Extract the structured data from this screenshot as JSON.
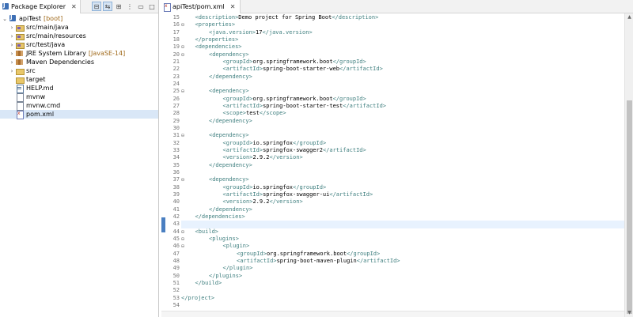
{
  "explorer": {
    "tab_label": "Package Explorer",
    "close_glyph": "✕",
    "toolbar": [
      "collapse-all",
      "link-with-editor",
      "filter",
      "view-menu",
      "minimize",
      "maximize"
    ],
    "tree": [
      {
        "label": "apiTest",
        "deco": "[boot]",
        "icon": "project-icon",
        "level": 0,
        "arrow": "⌄"
      },
      {
        "label": "src/main/java",
        "icon": "source-folder-icon",
        "level": 1,
        "arrow": "›"
      },
      {
        "label": "src/main/resources",
        "icon": "source-folder-icon",
        "level": 1,
        "arrow": "›"
      },
      {
        "label": "src/test/java",
        "icon": "source-folder-icon",
        "level": 1,
        "arrow": "›"
      },
      {
        "label": "JRE System Library",
        "deco": "[JavaSE-14]",
        "icon": "library-icon",
        "level": 1,
        "arrow": "›"
      },
      {
        "label": "Maven Dependencies",
        "icon": "library-icon",
        "level": 1,
        "arrow": "›"
      },
      {
        "label": "src",
        "icon": "folder-icon",
        "level": 1,
        "arrow": "›"
      },
      {
        "label": "target",
        "icon": "folder-icon",
        "level": 1,
        "arrow": ""
      },
      {
        "label": "HELP.md",
        "icon": "markdown-file-icon",
        "level": 1,
        "arrow": ""
      },
      {
        "label": "mvnw",
        "icon": "file-icon",
        "level": 1,
        "arrow": ""
      },
      {
        "label": "mvnw.cmd",
        "icon": "file-icon",
        "level": 1,
        "arrow": ""
      },
      {
        "label": "pom.xml",
        "icon": "xml-file-icon",
        "level": 1,
        "arrow": "",
        "selected": true
      }
    ]
  },
  "editor": {
    "tab_label": "apiTest/pom.xml",
    "current_line": "43",
    "lines": [
      {
        "n": "15",
        "fold": "",
        "indent": 1,
        "parts": [
          [
            "tag",
            "<description>"
          ],
          [
            "txt",
            "Demo project for Spring Boot"
          ],
          [
            "tag",
            "</description>"
          ]
        ]
      },
      {
        "n": "16",
        "fold": "⊖",
        "indent": 1,
        "parts": [
          [
            "tag",
            "<properties>"
          ]
        ]
      },
      {
        "n": "17",
        "fold": "",
        "indent": 2,
        "parts": [
          [
            "tag",
            "<java.version>"
          ],
          [
            "txt",
            "17"
          ],
          [
            "tag",
            "</java.version>"
          ]
        ]
      },
      {
        "n": "18",
        "fold": "",
        "indent": 1,
        "parts": [
          [
            "tag",
            "</properties>"
          ]
        ]
      },
      {
        "n": "19",
        "fold": "⊖",
        "indent": 1,
        "parts": [
          [
            "tag",
            "<dependencies>"
          ]
        ]
      },
      {
        "n": "20",
        "fold": "⊖",
        "indent": 2,
        "parts": [
          [
            "tag",
            "<dependency>"
          ]
        ]
      },
      {
        "n": "21",
        "fold": "",
        "indent": 3,
        "parts": [
          [
            "tag",
            "<groupId>"
          ],
          [
            "txt",
            "org.springframework.boot"
          ],
          [
            "tag",
            "</groupId>"
          ]
        ]
      },
      {
        "n": "22",
        "fold": "",
        "indent": 3,
        "parts": [
          [
            "tag",
            "<artifactId>"
          ],
          [
            "txt",
            "spring-boot-starter-web"
          ],
          [
            "tag",
            "</artifactId>"
          ]
        ]
      },
      {
        "n": "23",
        "fold": "",
        "indent": 2,
        "parts": [
          [
            "tag",
            "</dependency>"
          ]
        ]
      },
      {
        "n": "24",
        "fold": "",
        "indent": 0,
        "parts": []
      },
      {
        "n": "25",
        "fold": "⊖",
        "indent": 2,
        "parts": [
          [
            "tag",
            "<dependency>"
          ]
        ]
      },
      {
        "n": "26",
        "fold": "",
        "indent": 3,
        "parts": [
          [
            "tag",
            "<groupId>"
          ],
          [
            "txt",
            "org.springframework.boot"
          ],
          [
            "tag",
            "</groupId>"
          ]
        ]
      },
      {
        "n": "27",
        "fold": "",
        "indent": 3,
        "parts": [
          [
            "tag",
            "<artifactId>"
          ],
          [
            "txt",
            "spring-boot-starter-test"
          ],
          [
            "tag",
            "</artifactId>"
          ]
        ]
      },
      {
        "n": "28",
        "fold": "",
        "indent": 3,
        "parts": [
          [
            "tag",
            "<scope>"
          ],
          [
            "txt",
            "test"
          ],
          [
            "tag",
            "</scope>"
          ]
        ]
      },
      {
        "n": "29",
        "fold": "",
        "indent": 2,
        "parts": [
          [
            "tag",
            "</dependency>"
          ]
        ]
      },
      {
        "n": "30",
        "fold": "",
        "indent": 0,
        "parts": []
      },
      {
        "n": "31",
        "fold": "⊖",
        "indent": 2,
        "parts": [
          [
            "tag",
            "<dependency>"
          ]
        ]
      },
      {
        "n": "32",
        "fold": "",
        "indent": 3,
        "parts": [
          [
            "tag",
            "<groupId>"
          ],
          [
            "txt",
            "io.springfox"
          ],
          [
            "tag",
            "</groupId>"
          ]
        ]
      },
      {
        "n": "33",
        "fold": "",
        "indent": 3,
        "parts": [
          [
            "tag",
            "<artifactId>"
          ],
          [
            "txt",
            "springfox-swagger2"
          ],
          [
            "tag",
            "</artifactId>"
          ]
        ]
      },
      {
        "n": "34",
        "fold": "",
        "indent": 3,
        "parts": [
          [
            "tag",
            "<version>"
          ],
          [
            "txt",
            "2.9.2"
          ],
          [
            "tag",
            "</version>"
          ]
        ]
      },
      {
        "n": "35",
        "fold": "",
        "indent": 2,
        "parts": [
          [
            "tag",
            "</dependency>"
          ]
        ]
      },
      {
        "n": "36",
        "fold": "",
        "indent": 0,
        "parts": []
      },
      {
        "n": "37",
        "fold": "⊖",
        "indent": 2,
        "parts": [
          [
            "tag",
            "<dependency>"
          ]
        ]
      },
      {
        "n": "38",
        "fold": "",
        "indent": 3,
        "parts": [
          [
            "tag",
            "<groupId>"
          ],
          [
            "txt",
            "io.springfox"
          ],
          [
            "tag",
            "</groupId>"
          ]
        ]
      },
      {
        "n": "39",
        "fold": "",
        "indent": 3,
        "parts": [
          [
            "tag",
            "<artifactId>"
          ],
          [
            "txt",
            "springfox-swagger-ui"
          ],
          [
            "tag",
            "</artifactId>"
          ]
        ]
      },
      {
        "n": "40",
        "fold": "",
        "indent": 3,
        "parts": [
          [
            "tag",
            "<version>"
          ],
          [
            "txt",
            "2.9.2"
          ],
          [
            "tag",
            "</version>"
          ]
        ]
      },
      {
        "n": "41",
        "fold": "",
        "indent": 2,
        "parts": [
          [
            "tag",
            "</dependency>"
          ]
        ]
      },
      {
        "n": "42",
        "fold": "",
        "indent": 1,
        "parts": [
          [
            "tag",
            "</dependencies>"
          ]
        ]
      },
      {
        "n": "43",
        "fold": "",
        "indent": 0,
        "parts": []
      },
      {
        "n": "44",
        "fold": "⊖",
        "indent": 1,
        "parts": [
          [
            "tag",
            "<build>"
          ]
        ]
      },
      {
        "n": "45",
        "fold": "⊖",
        "indent": 2,
        "parts": [
          [
            "tag",
            "<plugins>"
          ]
        ]
      },
      {
        "n": "46",
        "fold": "⊖",
        "indent": 3,
        "parts": [
          [
            "tag",
            "<plugin>"
          ]
        ]
      },
      {
        "n": "47",
        "fold": "",
        "indent": 4,
        "parts": [
          [
            "tag",
            "<groupId>"
          ],
          [
            "txt",
            "org.springframework.boot"
          ],
          [
            "tag",
            "</groupId>"
          ]
        ]
      },
      {
        "n": "48",
        "fold": "",
        "indent": 4,
        "parts": [
          [
            "tag",
            "<artifactId>"
          ],
          [
            "txt",
            "spring-boot-maven-plugin"
          ],
          [
            "tag",
            "</artifactId>"
          ]
        ]
      },
      {
        "n": "49",
        "fold": "",
        "indent": 3,
        "parts": [
          [
            "tag",
            "</plugin>"
          ]
        ]
      },
      {
        "n": "50",
        "fold": "",
        "indent": 2,
        "parts": [
          [
            "tag",
            "</plugins>"
          ]
        ]
      },
      {
        "n": "51",
        "fold": "",
        "indent": 1,
        "parts": [
          [
            "tag",
            "</build>"
          ]
        ]
      },
      {
        "n": "52",
        "fold": "",
        "indent": 0,
        "parts": []
      },
      {
        "n": "53",
        "fold": "",
        "indent": 0,
        "parts": [
          [
            "tag",
            "</project>"
          ]
        ]
      },
      {
        "n": "54",
        "fold": "",
        "indent": 0,
        "parts": []
      }
    ]
  }
}
